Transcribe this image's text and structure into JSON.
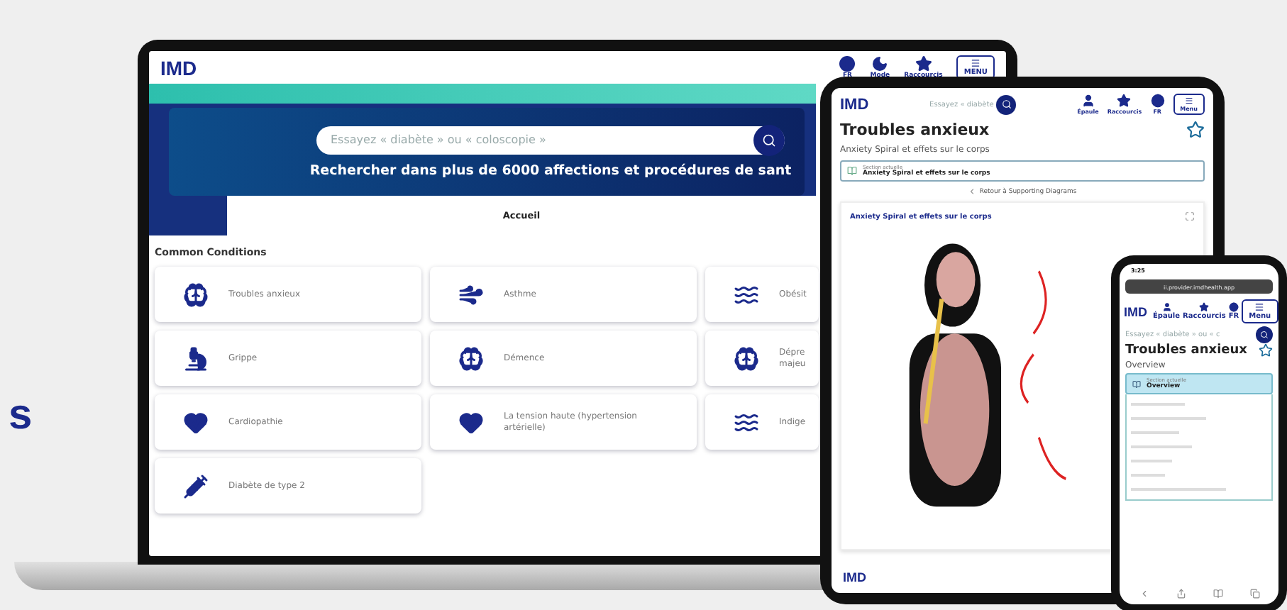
{
  "side_text": "s",
  "laptop": {
    "logo": "IMD",
    "header_items": [
      {
        "label": "FR"
      },
      {
        "label": "Mode"
      },
      {
        "label": "Raccourcis"
      }
    ],
    "menu_button": "MENU",
    "search": {
      "placeholder": "Essayez « diabète » ou « coloscopie »",
      "heading": "Rechercher dans plus de 6000 affections et procédures de sant"
    },
    "tabs": [
      {
        "label": "Accueil",
        "selected": true
      }
    ],
    "section_title": "Common Conditions",
    "conditions": [
      {
        "label": "Troubles anxieux"
      },
      {
        "label": "Asthme"
      },
      {
        "label": "Obésit"
      },
      {
        "label": "Grippe"
      },
      {
        "label": "Démence"
      },
      {
        "label": "Dépre majeu"
      },
      {
        "label": "Cardiopathie"
      },
      {
        "label": "La tension haute (hypertension artérielle)"
      },
      {
        "label": "Indige"
      },
      {
        "label": "Diabète de type 2"
      }
    ]
  },
  "tablet": {
    "logo": "IMD",
    "search_placeholder": "Essayez « diabète",
    "header_items": [
      {
        "label": "Épaule"
      },
      {
        "label": "Raccourcis"
      },
      {
        "label": "FR"
      }
    ],
    "menu_button": "Menu",
    "title": "Troubles anxieux",
    "subtitle": "Anxiety Spiral et effets sur le corps",
    "favorite": false,
    "section": {
      "caption": "Section actuelle",
      "value": "Anxiety Spiral et effets sur le corps"
    },
    "back_link": "Retour à Supporting Diagrams",
    "diagram_title": "Anxiety Spiral et effets sur le corps",
    "footer_logo": "IMD"
  },
  "phone": {
    "time": "3:25",
    "url": "ii.provider.imdhealth.app",
    "logo": "IMD",
    "header_items": [
      {
        "label": "Épaule"
      },
      {
        "label": "Raccourcis"
      },
      {
        "label": "FR"
      }
    ],
    "menu_button": "Menu",
    "search_placeholder": "Essayez « diabète » ou « c",
    "title": "Troubles anxieux",
    "subtitle": "Overview",
    "favorite": false,
    "section": {
      "caption": "Section actuelle",
      "value": "Overview"
    }
  }
}
